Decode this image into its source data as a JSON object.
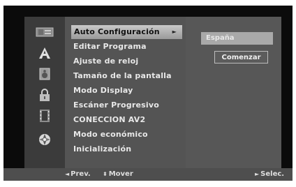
{
  "sidebar": {
    "icons": [
      "disc-icon",
      "language-a-icon",
      "speaker-icon",
      "lock-icon",
      "film-icon",
      "globe-icon"
    ]
  },
  "menu": {
    "items": [
      {
        "label": "Auto Configuración",
        "selected": true
      },
      {
        "label": "Editar Programa"
      },
      {
        "label": "Ajuste de reloj"
      },
      {
        "label": "Tamaño de la pantalla"
      },
      {
        "label": "Modo Display"
      },
      {
        "label": "Escáner Progresivo"
      },
      {
        "label": "CONECCION AV2"
      },
      {
        "label": "Modo económico"
      },
      {
        "label": "Inicialización"
      }
    ],
    "submenu_arrow": "►"
  },
  "options": {
    "country": "España",
    "start": "Comenzar"
  },
  "footer": {
    "prev_glyph": "◄",
    "prev_label": "Prev.",
    "move_glyph": "⬍",
    "move_label": "Mover",
    "select_glyph": "►",
    "select_label": "Selec."
  },
  "colors": {
    "screen_bg": "#0b0b0b",
    "sidebar_bg": "#3b3b3b",
    "menu_bg": "#545454",
    "selected_bg": "#b5b5b5",
    "footer_bg": "#4e4e4e"
  }
}
